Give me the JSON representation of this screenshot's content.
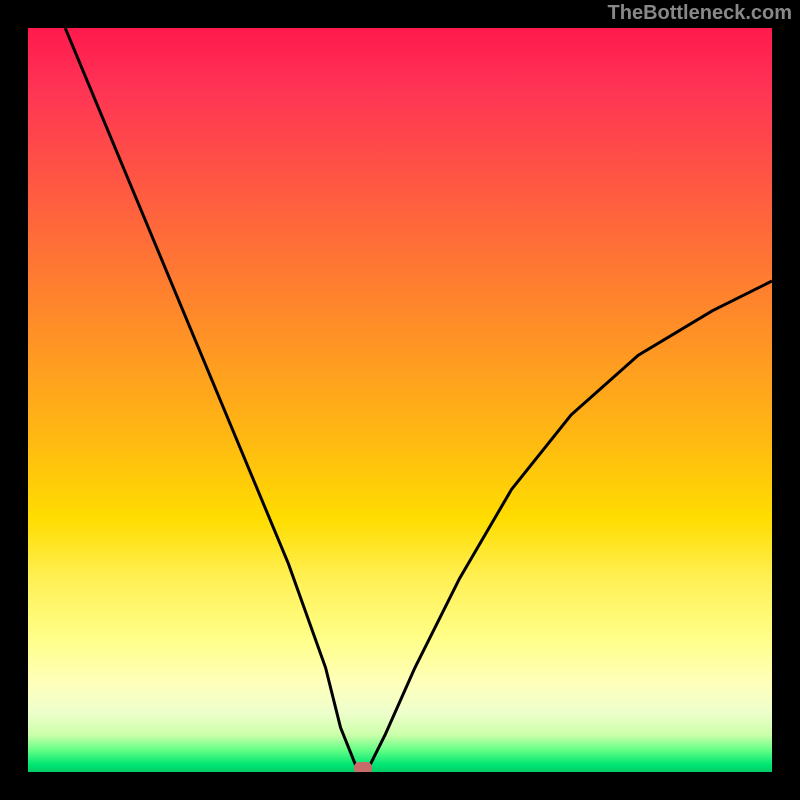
{
  "watermark": "TheBottleneck.com",
  "chart_data": {
    "type": "line",
    "title": "",
    "xlabel": "",
    "ylabel": "",
    "xlim": [
      0,
      100
    ],
    "ylim": [
      0,
      100
    ],
    "grid": false,
    "legend": false,
    "background_gradient": {
      "top": "#ff1a4d",
      "middle": "#ffdd00",
      "bottom": "#00cc66"
    },
    "series": [
      {
        "name": "bottleneck-curve",
        "x": [
          5,
          10,
          15,
          20,
          25,
          30,
          35,
          40,
          42,
          44,
          45,
          46,
          48,
          52,
          58,
          65,
          73,
          82,
          92,
          100
        ],
        "y": [
          100,
          88,
          76,
          64,
          52,
          40,
          28,
          14,
          6,
          1,
          0,
          1,
          5,
          14,
          26,
          38,
          48,
          56,
          62,
          66
        ]
      }
    ],
    "marker": {
      "name": "optimal-point",
      "x": 45,
      "y": 0,
      "color": "#c96b6b"
    }
  }
}
